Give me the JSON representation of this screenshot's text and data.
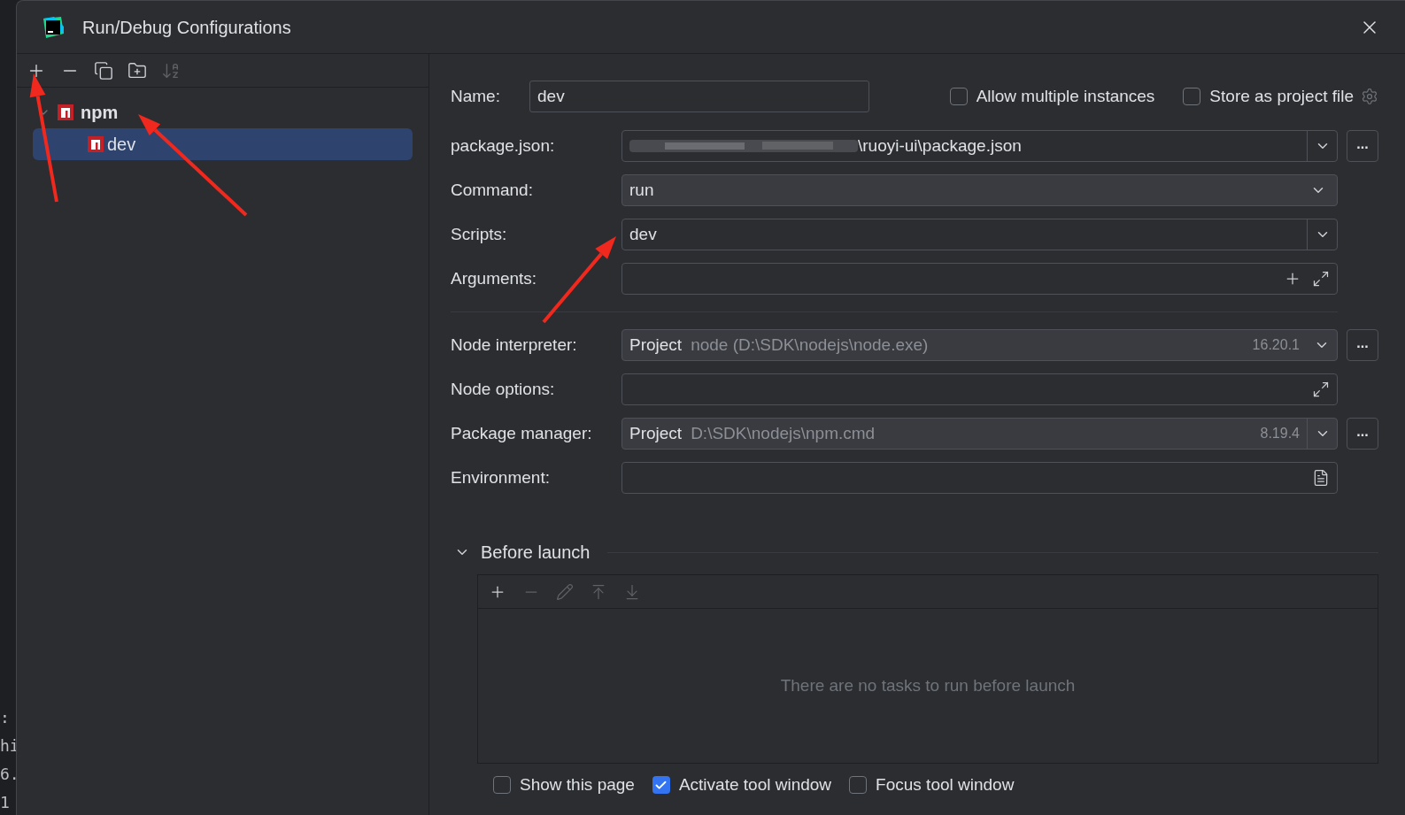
{
  "background_lines": [
    ":",
    "hi",
    "6.",
    "1"
  ],
  "window": {
    "title": "Run/Debug Configurations"
  },
  "toolbar": [
    {
      "kind": "add",
      "disabled": false
    },
    {
      "kind": "remove",
      "disabled": false
    },
    {
      "kind": "copy",
      "disabled": false
    },
    {
      "kind": "folder",
      "disabled": false
    },
    {
      "kind": "sort",
      "disabled": true
    }
  ],
  "tree": [
    {
      "label": "npm",
      "expanded": true,
      "selected": false,
      "children": [
        {
          "label": "dev",
          "selected": true
        }
      ]
    }
  ],
  "name": {
    "label": "Name:",
    "value": "dev"
  },
  "top_options": [
    {
      "label": "Allow multiple instances",
      "checked": false,
      "gear": false
    },
    {
      "label": "Store as project file",
      "checked": false,
      "gear": true
    }
  ],
  "fields": [
    {
      "label": "package.json:",
      "kind": "combo",
      "value": "\\ruoyi-ui\\package.json",
      "redacted": true,
      "browse": "..."
    },
    {
      "label": "Command:",
      "kind": "select",
      "value": "run"
    },
    {
      "label": "Scripts:",
      "kind": "combo",
      "value": "dev",
      "redacted": false
    },
    {
      "label": "Arguments:",
      "kind": "arguments"
    }
  ],
  "node_fields": [
    {
      "label": "Node interpreter:",
      "kind": "sdk",
      "prefix": "Project",
      "value": "node (D:\\SDK\\nodejs\\node.exe)",
      "version": "16.20.1",
      "browse": "..."
    },
    {
      "label": "Node options:",
      "kind": "expand"
    },
    {
      "label": "Package manager:",
      "kind": "sdk-combo",
      "prefix": "Project",
      "value": "D:\\SDK\\nodejs\\npm.cmd",
      "version": "8.19.4",
      "browse": "..."
    },
    {
      "label": "Environment:",
      "kind": "env"
    }
  ],
  "before_launch": {
    "label": "Before launch",
    "expanded": true,
    "tools": [
      {
        "kind": "add",
        "disabled": false
      },
      {
        "kind": "remove",
        "disabled": true
      },
      {
        "kind": "edit",
        "disabled": true
      },
      {
        "kind": "up",
        "disabled": true
      },
      {
        "kind": "down",
        "disabled": true
      }
    ],
    "empty_text": "There are no tasks to run before launch"
  },
  "bottom_options": [
    {
      "label": "Show this page",
      "checked": false
    },
    {
      "label": "Activate tool window",
      "checked": true
    },
    {
      "label": "Focus tool window",
      "checked": false
    }
  ]
}
